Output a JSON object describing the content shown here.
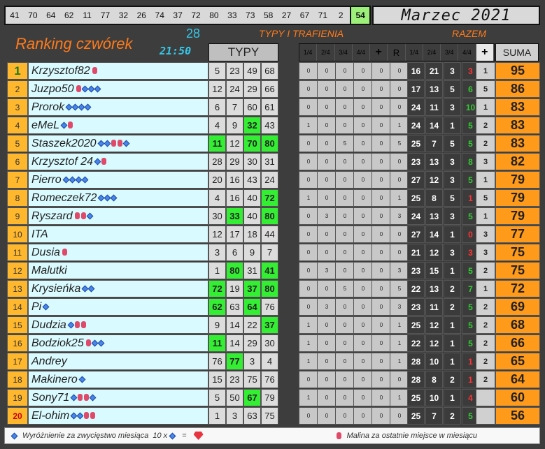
{
  "top_numbers": [
    "41",
    "70",
    "64",
    "62",
    "11",
    "77",
    "32",
    "26",
    "74",
    "37",
    "72",
    "80",
    "33",
    "73",
    "58",
    "27",
    "67",
    "71",
    "2",
    "54"
  ],
  "month": "Marzec 2021",
  "title": "Ranking czwórek",
  "count": "28",
  "time": "21:50",
  "section_typy_trafienia": "TYPY I TRAFIENIA",
  "section_razem": "RAZEM",
  "col_typy": "TYPY",
  "stat_headers": [
    "1/4",
    "2/4",
    "3/4",
    "4/4",
    "+",
    "R",
    "1/4",
    "2/4",
    "3/4",
    "4/4",
    "+"
  ],
  "col_suma": "SUMA",
  "rows": [
    {
      "rank": "1",
      "name": "Krzysztof82",
      "deco": "r",
      "typy": [
        "5",
        "23",
        "49",
        "68"
      ],
      "hits": [
        0,
        0,
        0,
        0
      ],
      "stats": [
        "0",
        "0",
        "0",
        "0",
        "0",
        "0"
      ],
      "razem": [
        "16",
        "21",
        "3",
        "3"
      ],
      "razem_colors": [
        "",
        "",
        "",
        "r"
      ],
      "plus": "1",
      "suma": "95"
    },
    {
      "rank": "2",
      "name": "Juzpo50",
      "deco": "rddd",
      "typy": [
        "12",
        "24",
        "29",
        "66"
      ],
      "hits": [
        0,
        0,
        0,
        0
      ],
      "stats": [
        "0",
        "0",
        "0",
        "0",
        "0",
        "0"
      ],
      "razem": [
        "17",
        "13",
        "5",
        "6"
      ],
      "razem_colors": [
        "",
        "",
        "",
        "g"
      ],
      "plus": "5",
      "suma": "86"
    },
    {
      "rank": "3",
      "name": "Prorok",
      "deco": "dddd",
      "typy": [
        "6",
        "7",
        "60",
        "61"
      ],
      "hits": [
        0,
        0,
        0,
        0
      ],
      "stats": [
        "0",
        "0",
        "0",
        "0",
        "0",
        "0"
      ],
      "razem": [
        "24",
        "11",
        "3",
        "10"
      ],
      "razem_colors": [
        "",
        "",
        "",
        "g"
      ],
      "plus": "1",
      "suma": "83"
    },
    {
      "rank": "4",
      "name": "eMeL",
      "deco": "dr",
      "typy": [
        "4",
        "9",
        "32",
        "43"
      ],
      "hits": [
        0,
        0,
        1,
        0
      ],
      "stats": [
        "1",
        "0",
        "0",
        "0",
        "0",
        "1"
      ],
      "razem": [
        "24",
        "14",
        "1",
        "5"
      ],
      "razem_colors": [
        "",
        "",
        "",
        "g"
      ],
      "plus": "2",
      "suma": "83"
    },
    {
      "rank": "5",
      "name": "Staszek2020",
      "deco": "ddrrd",
      "typy": [
        "11",
        "12",
        "70",
        "80"
      ],
      "hits": [
        1,
        0,
        1,
        1
      ],
      "stats": [
        "0",
        "0",
        "5",
        "0",
        "0",
        "5"
      ],
      "razem": [
        "25",
        "7",
        "5",
        "5"
      ],
      "razem_colors": [
        "",
        "",
        "",
        "g"
      ],
      "plus": "2",
      "suma": "83"
    },
    {
      "rank": "6",
      "name": "Krzysztof 24",
      "deco": "dr",
      "typy": [
        "28",
        "29",
        "30",
        "31"
      ],
      "hits": [
        0,
        0,
        0,
        0
      ],
      "stats": [
        "0",
        "0",
        "0",
        "0",
        "0",
        "0"
      ],
      "razem": [
        "23",
        "13",
        "3",
        "8"
      ],
      "razem_colors": [
        "",
        "",
        "",
        "g"
      ],
      "plus": "3",
      "suma": "82"
    },
    {
      "rank": "7",
      "name": "Pierro",
      "deco": "dddd",
      "typy": [
        "20",
        "16",
        "43",
        "24"
      ],
      "hits": [
        0,
        0,
        0,
        0
      ],
      "stats": [
        "0",
        "0",
        "0",
        "0",
        "0",
        "0"
      ],
      "razem": [
        "27",
        "12",
        "3",
        "5"
      ],
      "razem_colors": [
        "",
        "",
        "",
        "g"
      ],
      "plus": "1",
      "suma": "79"
    },
    {
      "rank": "8",
      "name": "Romeczek72",
      "deco": "ddd",
      "typy": [
        "4",
        "16",
        "40",
        "72"
      ],
      "hits": [
        0,
        0,
        0,
        1
      ],
      "stats": [
        "1",
        "0",
        "0",
        "0",
        "0",
        "1"
      ],
      "razem": [
        "25",
        "8",
        "5",
        "1"
      ],
      "razem_colors": [
        "",
        "",
        "",
        "r"
      ],
      "plus": "5",
      "suma": "79"
    },
    {
      "rank": "9",
      "name": "Ryszard",
      "deco": "rrd",
      "typy": [
        "30",
        "33",
        "40",
        "80"
      ],
      "hits": [
        0,
        1,
        0,
        1
      ],
      "stats": [
        "0",
        "3",
        "0",
        "0",
        "0",
        "3"
      ],
      "razem": [
        "24",
        "13",
        "3",
        "5"
      ],
      "razem_colors": [
        "",
        "",
        "",
        "g"
      ],
      "plus": "1",
      "suma": "79"
    },
    {
      "rank": "10",
      "name": "ITA",
      "deco": "",
      "typy": [
        "12",
        "17",
        "18",
        "44"
      ],
      "hits": [
        0,
        0,
        0,
        0
      ],
      "stats": [
        "0",
        "0",
        "0",
        "0",
        "0",
        "0"
      ],
      "razem": [
        "27",
        "14",
        "1",
        "0"
      ],
      "razem_colors": [
        "",
        "",
        "",
        "r"
      ],
      "plus": "3",
      "suma": "77"
    },
    {
      "rank": "11",
      "name": "Dusia",
      "deco": "r",
      "typy": [
        "3",
        "6",
        "9",
        "7"
      ],
      "hits": [
        0,
        0,
        0,
        0
      ],
      "stats": [
        "0",
        "0",
        "0",
        "0",
        "0",
        "0"
      ],
      "razem": [
        "21",
        "12",
        "3",
        "3"
      ],
      "razem_colors": [
        "",
        "",
        "",
        "r"
      ],
      "plus": "3",
      "suma": "75"
    },
    {
      "rank": "12",
      "name": "Malutki",
      "deco": "",
      "typy": [
        "1",
        "80",
        "31",
        "41"
      ],
      "hits": [
        0,
        1,
        0,
        1
      ],
      "stats": [
        "0",
        "3",
        "0",
        "0",
        "0",
        "3"
      ],
      "razem": [
        "23",
        "15",
        "1",
        "5"
      ],
      "razem_colors": [
        "",
        "",
        "",
        "g"
      ],
      "plus": "2",
      "suma": "75"
    },
    {
      "rank": "13",
      "name": "Krysieńka",
      "deco": "dd",
      "typy": [
        "72",
        "19",
        "37",
        "80"
      ],
      "hits": [
        1,
        0,
        1,
        1
      ],
      "stats": [
        "0",
        "0",
        "5",
        "0",
        "0",
        "5"
      ],
      "razem": [
        "22",
        "13",
        "2",
        "7"
      ],
      "razem_colors": [
        "",
        "",
        "",
        "g"
      ],
      "plus": "1",
      "suma": "72"
    },
    {
      "rank": "14",
      "name": "Pi",
      "deco": "d",
      "typy": [
        "62",
        "63",
        "64",
        "76"
      ],
      "hits": [
        1,
        0,
        1,
        0
      ],
      "stats": [
        "0",
        "3",
        "0",
        "0",
        "0",
        "3"
      ],
      "razem": [
        "23",
        "11",
        "2",
        "5"
      ],
      "razem_colors": [
        "",
        "",
        "",
        "g"
      ],
      "plus": "2",
      "suma": "69"
    },
    {
      "rank": "15",
      "name": "Dudzia",
      "deco": "drr",
      "typy": [
        "9",
        "14",
        "22",
        "37"
      ],
      "hits": [
        0,
        0,
        0,
        1
      ],
      "stats": [
        "1",
        "0",
        "0",
        "0",
        "0",
        "1"
      ],
      "razem": [
        "25",
        "12",
        "1",
        "5"
      ],
      "razem_colors": [
        "",
        "",
        "",
        "g"
      ],
      "plus": "2",
      "suma": "68"
    },
    {
      "rank": "16",
      "name": "Bodziok25",
      "deco": "rdd",
      "typy": [
        "11",
        "14",
        "29",
        "30"
      ],
      "hits": [
        1,
        0,
        0,
        0
      ],
      "stats": [
        "1",
        "0",
        "0",
        "0",
        "0",
        "1"
      ],
      "razem": [
        "22",
        "12",
        "1",
        "5"
      ],
      "razem_colors": [
        "",
        "",
        "",
        "g"
      ],
      "plus": "2",
      "suma": "66"
    },
    {
      "rank": "17",
      "name": "Andrey",
      "deco": "",
      "typy": [
        "76",
        "77",
        "3",
        "4"
      ],
      "hits": [
        0,
        1,
        0,
        0
      ],
      "stats": [
        "1",
        "0",
        "0",
        "0",
        "0",
        "1"
      ],
      "razem": [
        "28",
        "10",
        "1",
        "1"
      ],
      "razem_colors": [
        "",
        "",
        "",
        "r"
      ],
      "plus": "2",
      "suma": "65"
    },
    {
      "rank": "18",
      "name": "Makinero",
      "deco": "d",
      "typy": [
        "15",
        "23",
        "75",
        "76"
      ],
      "hits": [
        0,
        0,
        0,
        0
      ],
      "stats": [
        "0",
        "0",
        "0",
        "0",
        "0",
        "0"
      ],
      "razem": [
        "28",
        "8",
        "2",
        "1"
      ],
      "razem_colors": [
        "",
        "",
        "",
        "r"
      ],
      "plus": "2",
      "suma": "64"
    },
    {
      "rank": "19",
      "name": "Sony71",
      "deco": "drrd",
      "typy": [
        "5",
        "50",
        "67",
        "79"
      ],
      "hits": [
        0,
        0,
        1,
        0
      ],
      "stats": [
        "1",
        "0",
        "0",
        "0",
        "0",
        "1"
      ],
      "razem": [
        "25",
        "10",
        "1",
        "4"
      ],
      "razem_colors": [
        "",
        "",
        "",
        "r"
      ],
      "plus": "",
      "suma": "60"
    },
    {
      "rank": "20",
      "name": "El-ohim",
      "deco": "ddrr",
      "typy": [
        "1",
        "3",
        "63",
        "75"
      ],
      "hits": [
        0,
        0,
        0,
        0
      ],
      "stats": [
        "0",
        "0",
        "0",
        "0",
        "0",
        "0"
      ],
      "razem": [
        "25",
        "7",
        "2",
        "5"
      ],
      "razem_colors": [
        "",
        "",
        "",
        "g"
      ],
      "plus": "",
      "suma": "56"
    }
  ],
  "footer_left": "Wyróżnienie za zwycięstwo miesiąca",
  "footer_10x": "10 x",
  "footer_eq": "=",
  "footer_right": "Malina za ostatnie miejsce w miesiącu",
  "colors": {
    "accent_orange": "#ff7a1a",
    "cyan": "#35c8e8",
    "hit_green": "#33ee33",
    "sum_orange": "#ff9a1a"
  }
}
